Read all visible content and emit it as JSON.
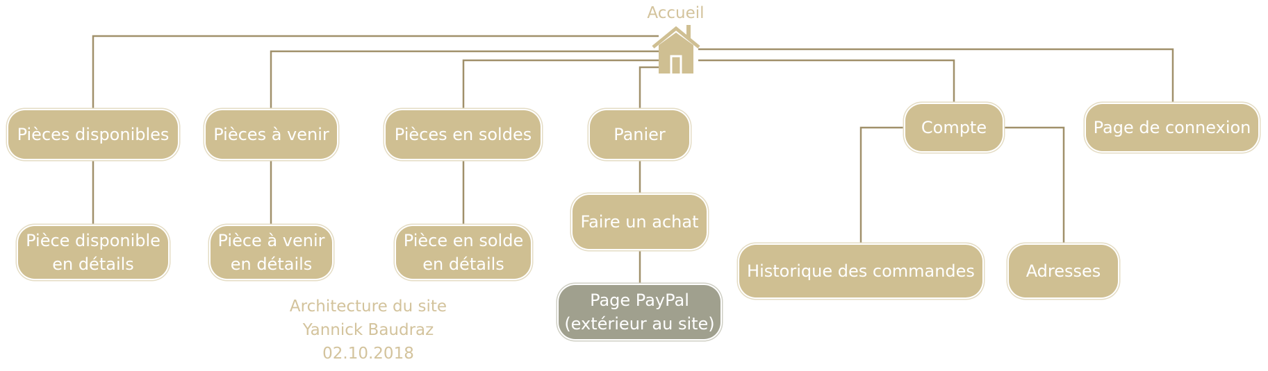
{
  "home": {
    "label": "Accueil"
  },
  "nodes": {
    "pieces_disponibles": "Pièces disponibles",
    "piece_disponible_detail": [
      "Pièce disponible",
      "en détails"
    ],
    "pieces_a_venir": "Pièces à venir",
    "piece_a_venir_detail": [
      "Pièce à venir",
      "en détails"
    ],
    "pieces_en_soldes": "Pièces en soldes",
    "piece_en_solde_detail": [
      "Pièce en solde",
      "en détails"
    ],
    "panier": "Panier",
    "faire_un_achat": "Faire un achat",
    "page_paypal": [
      "Page PayPal",
      "(extérieur au site)"
    ],
    "compte": "Compte",
    "historique": "Historique des commandes",
    "adresses": "Adresses",
    "page_connexion": "Page de connexion"
  },
  "credits": [
    "Architecture du site",
    "Yannick Baudraz",
    "02.10.2018"
  ],
  "colors": {
    "node_fill": "#cfbf92",
    "external_fill": "#a0a08e",
    "connector": "#a0906a",
    "text_muted": "#d3c39c"
  }
}
